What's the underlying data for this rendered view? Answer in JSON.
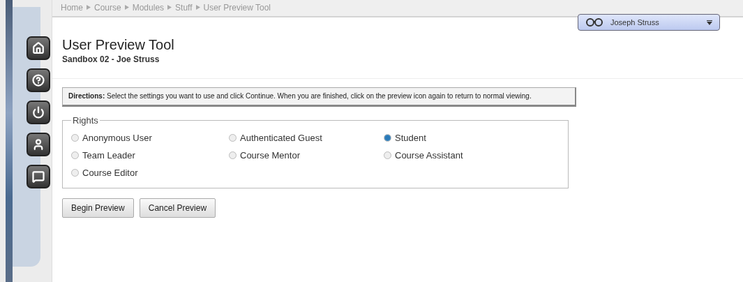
{
  "breadcrumb": [
    "Home",
    "Course",
    "Modules",
    "Stuff",
    "User Preview Tool"
  ],
  "user_menu": {
    "name": "Joseph Struss"
  },
  "sidebar": {
    "items": [
      {
        "kind": "home"
      },
      {
        "kind": "help"
      },
      {
        "kind": "power"
      },
      {
        "kind": "person"
      },
      {
        "kind": "chat"
      }
    ]
  },
  "page": {
    "title": "User Preview Tool",
    "subtitle": "Sandbox 02 - Joe Struss"
  },
  "directions": "**Directions:** Select the settings you want to use and click Continue. When you are finished, click on the preview icon again to return to normal viewing.",
  "rights": {
    "legend": "Rights",
    "options": [
      {
        "label": "Anonymous User",
        "selected": false
      },
      {
        "label": "Authenticated Guest",
        "selected": false
      },
      {
        "label": "Student",
        "selected": true
      },
      {
        "label": "Team Leader",
        "selected": false
      },
      {
        "label": "Course Mentor",
        "selected": false
      },
      {
        "label": "Course Assistant",
        "selected": false
      },
      {
        "label": "Course Editor",
        "selected": false
      }
    ]
  },
  "buttons": [
    "Begin Preview",
    "Cancel Preview"
  ]
}
